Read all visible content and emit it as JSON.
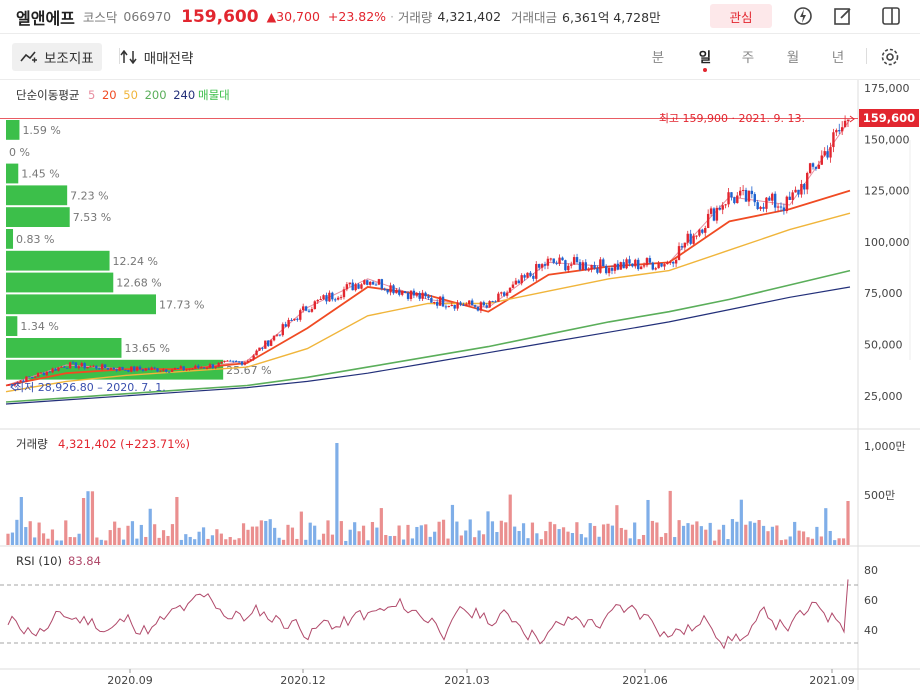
{
  "header": {
    "name": "엘앤에프",
    "market": "코스닥",
    "code": "066970",
    "price": "159,600",
    "change": "▲30,700",
    "change_pct": "+23.82%",
    "volume_label": "거래량",
    "volume": "4,321,402",
    "amount_label": "거래대금",
    "amount": "6,361억 4,728만",
    "fav_label": "관심"
  },
  "toolbar": {
    "indicator_label": "보조지표",
    "strategy_label": "매매전략",
    "periods": [
      "분",
      "일",
      "주",
      "월",
      "년"
    ],
    "active_period": "일"
  },
  "colors": {
    "up": "#e2262f",
    "down": "#1e62d0",
    "ma5": "#e88ea0",
    "ma20": "#f04b23",
    "ma50": "#f0b53b",
    "ma200": "#5aae5a",
    "ma240": "#23307a",
    "volume_profile": "#3cbf4a"
  },
  "price_chart": {
    "legend_label": "단순이동평균",
    "ma_periods": [
      "5",
      "20",
      "50",
      "200",
      "240"
    ],
    "vp_label": "매물대",
    "high_note": "최고 159,900 · 2021. 9. 13.",
    "low_note": "최저 28,926.80 – 2020. 7. 1.",
    "current_price_tag": "159,600",
    "y_ticks": [
      "175,000",
      "150,000",
      "125,000",
      "100,000",
      "75,000",
      "50,000",
      "25,000"
    ],
    "volume_profile": [
      "1.59 %",
      "0 %",
      "1.45 %",
      "7.23 %",
      "7.53 %",
      "0.83 %",
      "12.24 %",
      "12.68 %",
      "17.73 %",
      "1.34 %",
      "13.65 %",
      "25.67 %"
    ]
  },
  "volume_chart": {
    "label": "거래량",
    "value": "4,321,402 (+223.71%)",
    "y_ticks": [
      "1,000만",
      "500만"
    ]
  },
  "rsi_chart": {
    "label": "RSI (10)",
    "value": "83.84",
    "y_ticks": [
      "80",
      "60",
      "40"
    ]
  },
  "x_axis": {
    "ticks": [
      "2020.09",
      "2020.12",
      "2021.03",
      "2021.06",
      "2021.09"
    ]
  },
  "chart_data": {
    "type": "line",
    "title": "",
    "x": [
      "2020.07",
      "2020.08",
      "2020.09",
      "2020.10",
      "2020.11",
      "2020.12",
      "2021.01",
      "2021.02",
      "2021.03",
      "2021.04",
      "2021.05",
      "2021.06",
      "2021.07",
      "2021.08",
      "2021.09"
    ],
    "series": [
      {
        "name": "5",
        "values": [
          30000,
          40000,
          38000,
          38000,
          42000,
          68000,
          82000,
          72000,
          68000,
          90000,
          88000,
          90000,
          122000,
          118000,
          159600
        ]
      },
      {
        "name": "20",
        "values": [
          30000,
          36000,
          38000,
          38000,
          41000,
          58000,
          78000,
          74000,
          66000,
          84000,
          88000,
          90000,
          110000,
          116000,
          125000
        ]
      },
      {
        "name": "50",
        "values": [
          27000,
          32000,
          35000,
          37000,
          39000,
          48000,
          64000,
          70000,
          70000,
          76000,
          82000,
          86000,
          96000,
          106000,
          114000
        ]
      },
      {
        "name": "200",
        "values": [
          22000,
          24000,
          26000,
          28000,
          30000,
          34000,
          39000,
          44000,
          49000,
          55000,
          61000,
          66000,
          72000,
          79000,
          86000
        ]
      },
      {
        "name": "240",
        "values": [
          21000,
          23000,
          25000,
          27000,
          29000,
          32000,
          36000,
          41000,
          46000,
          51000,
          56000,
          61000,
          67000,
          73000,
          78000
        ]
      }
    ],
    "ylim": [
      15000,
      180000
    ],
    "rsi": {
      "name": "RSI (10)",
      "ylim": [
        20,
        90
      ],
      "last": 83.84
    },
    "volume": {
      "last": 4321402
    }
  }
}
